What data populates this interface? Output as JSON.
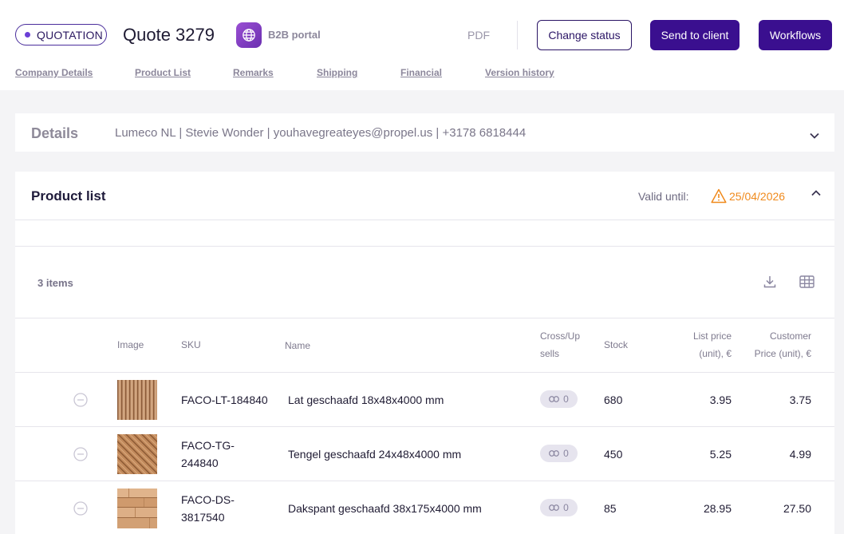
{
  "header": {
    "status_badge": "QUOTATION",
    "quote_title": "Quote 3279",
    "portal_label": "B2B portal",
    "pdf_label": "PDF",
    "change_status_label": "Change status",
    "send_label": "Send to client",
    "workflows_label": "Workflows",
    "nav": [
      "Company Details",
      "Product List",
      "Remarks",
      "Shipping",
      "Financial",
      "Version history"
    ]
  },
  "details": {
    "title": "Details",
    "info": "Lumeco NL | Stevie Wonder | youhavegreateyes@propel.us | +3178 6818444"
  },
  "product_list": {
    "title": "Product list",
    "valid_label": "Valid until:",
    "valid_date": "25/04/2026",
    "items_count": "3 items",
    "columns": {
      "image": "Image",
      "sku": "SKU",
      "name": "Name",
      "cross_line1": "Cross/Up",
      "cross_line2": "sells",
      "stock": "Stock",
      "list_line1": "List price",
      "list_line2": "(unit), €",
      "cust_line1": "Customer",
      "cust_line2": "Price (unit), €"
    },
    "rows": [
      {
        "sku_line1": "FACO-LT-184840",
        "sku_line2": "",
        "name": "Lat geschaafd 18x48x4000 mm",
        "cross_sells": "0",
        "stock": "680",
        "list_price": "3.95",
        "customer_price": "3.75"
      },
      {
        "sku_line1": "FACO-TG-",
        "sku_line2": "244840",
        "name": "Tengel geschaafd 24x48x4000 mm",
        "cross_sells": "0",
        "stock": "450",
        "list_price": "5.25",
        "customer_price": "4.99"
      },
      {
        "sku_line1": "FACO-DS-",
        "sku_line2": "3817540",
        "name": "Dakspant geschaafd 38x175x4000 mm",
        "cross_sells": "0",
        "stock": "85",
        "list_price": "28.95",
        "customer_price": "27.50"
      }
    ]
  },
  "colors": {
    "primary": "#3a0f8f",
    "warning": "#f08a1c",
    "badge_dot": "#6b3fd6"
  },
  "icons": [
    "globe-icon",
    "chevron-down-icon",
    "chevron-up-icon",
    "warning-icon",
    "download-icon",
    "grid-icon",
    "minus-circle-icon",
    "link-icon"
  ]
}
